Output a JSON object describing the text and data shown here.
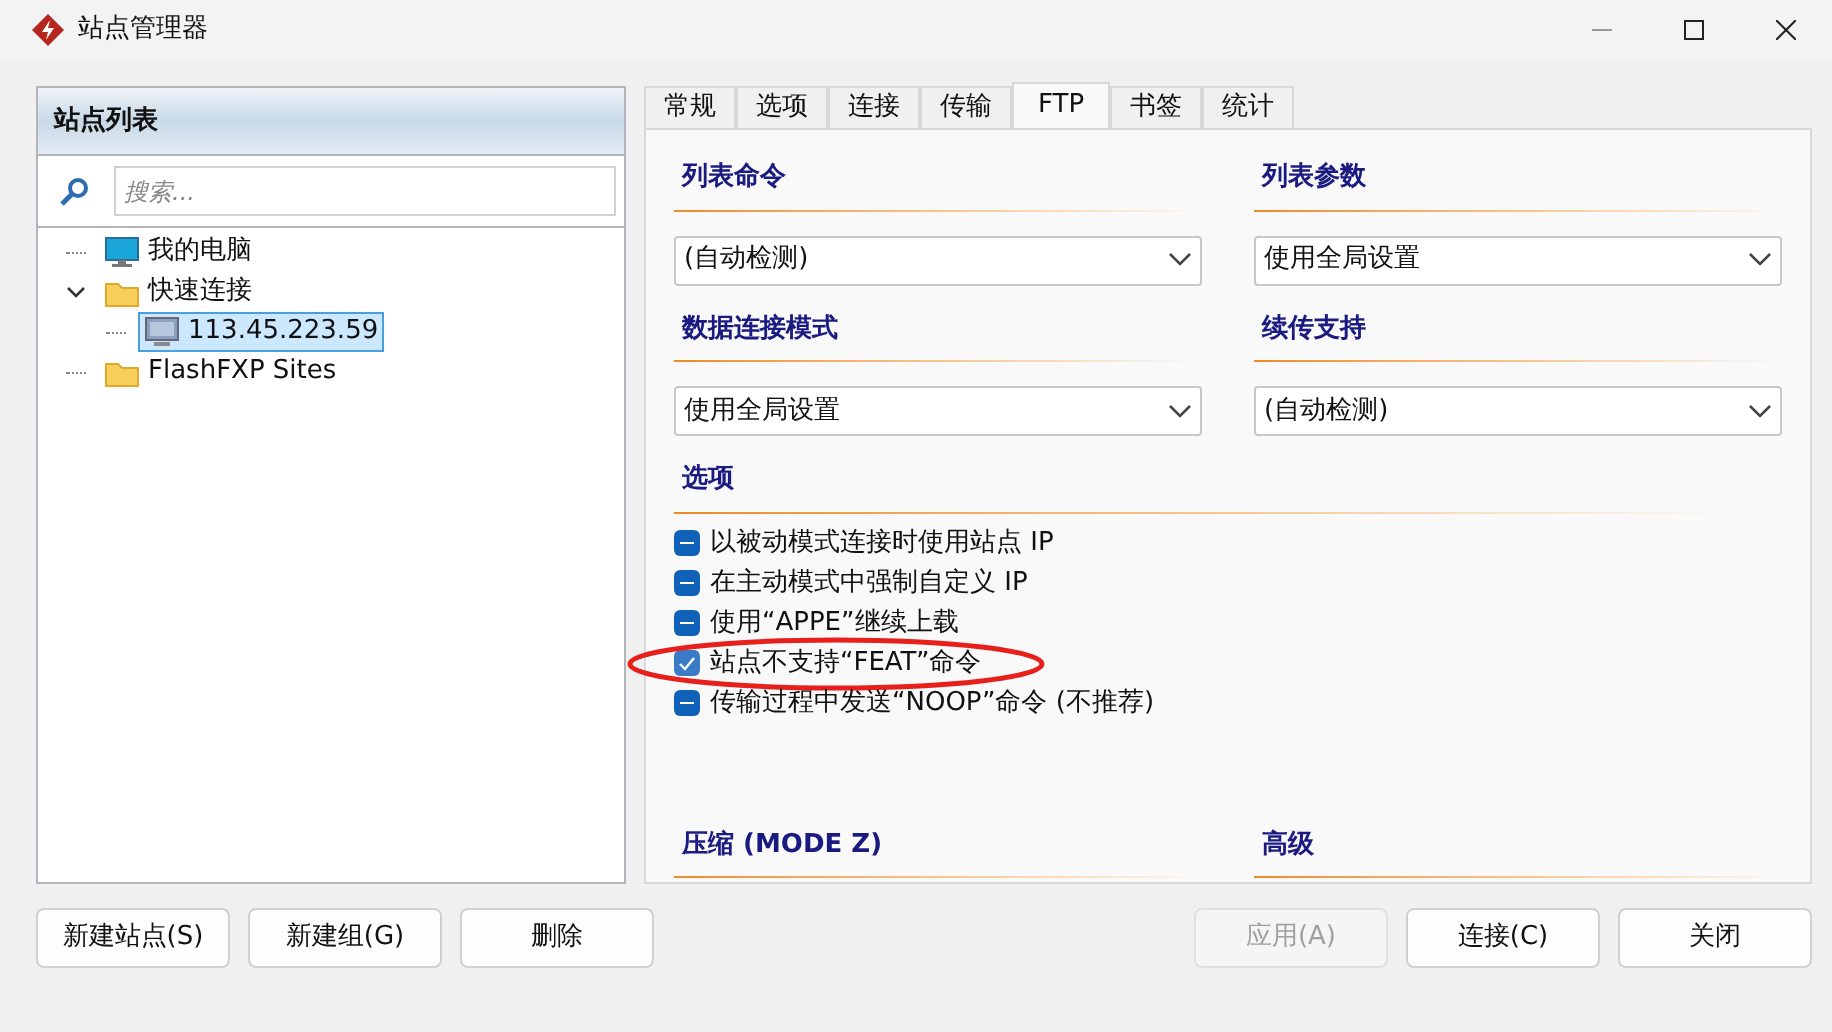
{
  "window": {
    "title": "站点管理器"
  },
  "site_list": {
    "title": "站点列表",
    "search": {
      "placeholder": "搜索..."
    },
    "tree": [
      {
        "label": "我的电脑",
        "kind": "computer",
        "selected": false
      },
      {
        "label": "快速连接",
        "kind": "folder",
        "expanded": true,
        "selected": false,
        "children": [
          {
            "label": "113.45.223.59",
            "kind": "site",
            "selected": true
          }
        ]
      },
      {
        "label": "FlashFXP Sites",
        "kind": "folder",
        "selected": false
      }
    ]
  },
  "tabs": [
    {
      "label": "常规",
      "selected": false
    },
    {
      "label": "选项",
      "selected": false
    },
    {
      "label": "连接",
      "selected": false
    },
    {
      "label": "传输",
      "selected": false
    },
    {
      "label": "FTP",
      "selected": true
    },
    {
      "label": "书签",
      "selected": false
    },
    {
      "label": "统计",
      "selected": false
    }
  ],
  "sections": [
    {
      "title": "列表命令",
      "dropdown": "(自动检测)"
    },
    {
      "title": "列表参数",
      "dropdown": "使用全局设置"
    },
    {
      "title": "数据连接模式",
      "dropdown": "使用全局设置"
    },
    {
      "title": "续传支持",
      "dropdown": "(自动检测)"
    }
  ],
  "options": {
    "title": "选项",
    "items": [
      {
        "label": "以被动模式连接时使用站点 IP",
        "checked": true,
        "indeterminate": true,
        "highlighted": false
      },
      {
        "label": "在主动模式中强制自定义 IP",
        "checked": true,
        "indeterminate": true,
        "highlighted": false
      },
      {
        "label": "使用“APPE”继续上载",
        "checked": true,
        "indeterminate": true,
        "highlighted": false
      },
      {
        "label": "站点不支持“FEAT”命令",
        "checked": true,
        "indeterminate": false,
        "highlighted": true
      },
      {
        "label": "传输过程中发送“NOOP”命令 (不推荐)",
        "checked": true,
        "indeterminate": true,
        "highlighted": false
      }
    ]
  },
  "lower_sections": [
    {
      "title": "压缩 (MODE Z)"
    },
    {
      "title": "高级"
    }
  ],
  "buttons_left": [
    {
      "label": "新建站点(S)",
      "disabled": false
    },
    {
      "label": "新建组(G)",
      "disabled": false
    },
    {
      "label": "删除",
      "disabled": false
    }
  ],
  "buttons_right": [
    {
      "label": "应用(A)",
      "disabled": true
    },
    {
      "label": "连接(C)",
      "disabled": false
    },
    {
      "label": "关闭",
      "disabled": false
    }
  ]
}
